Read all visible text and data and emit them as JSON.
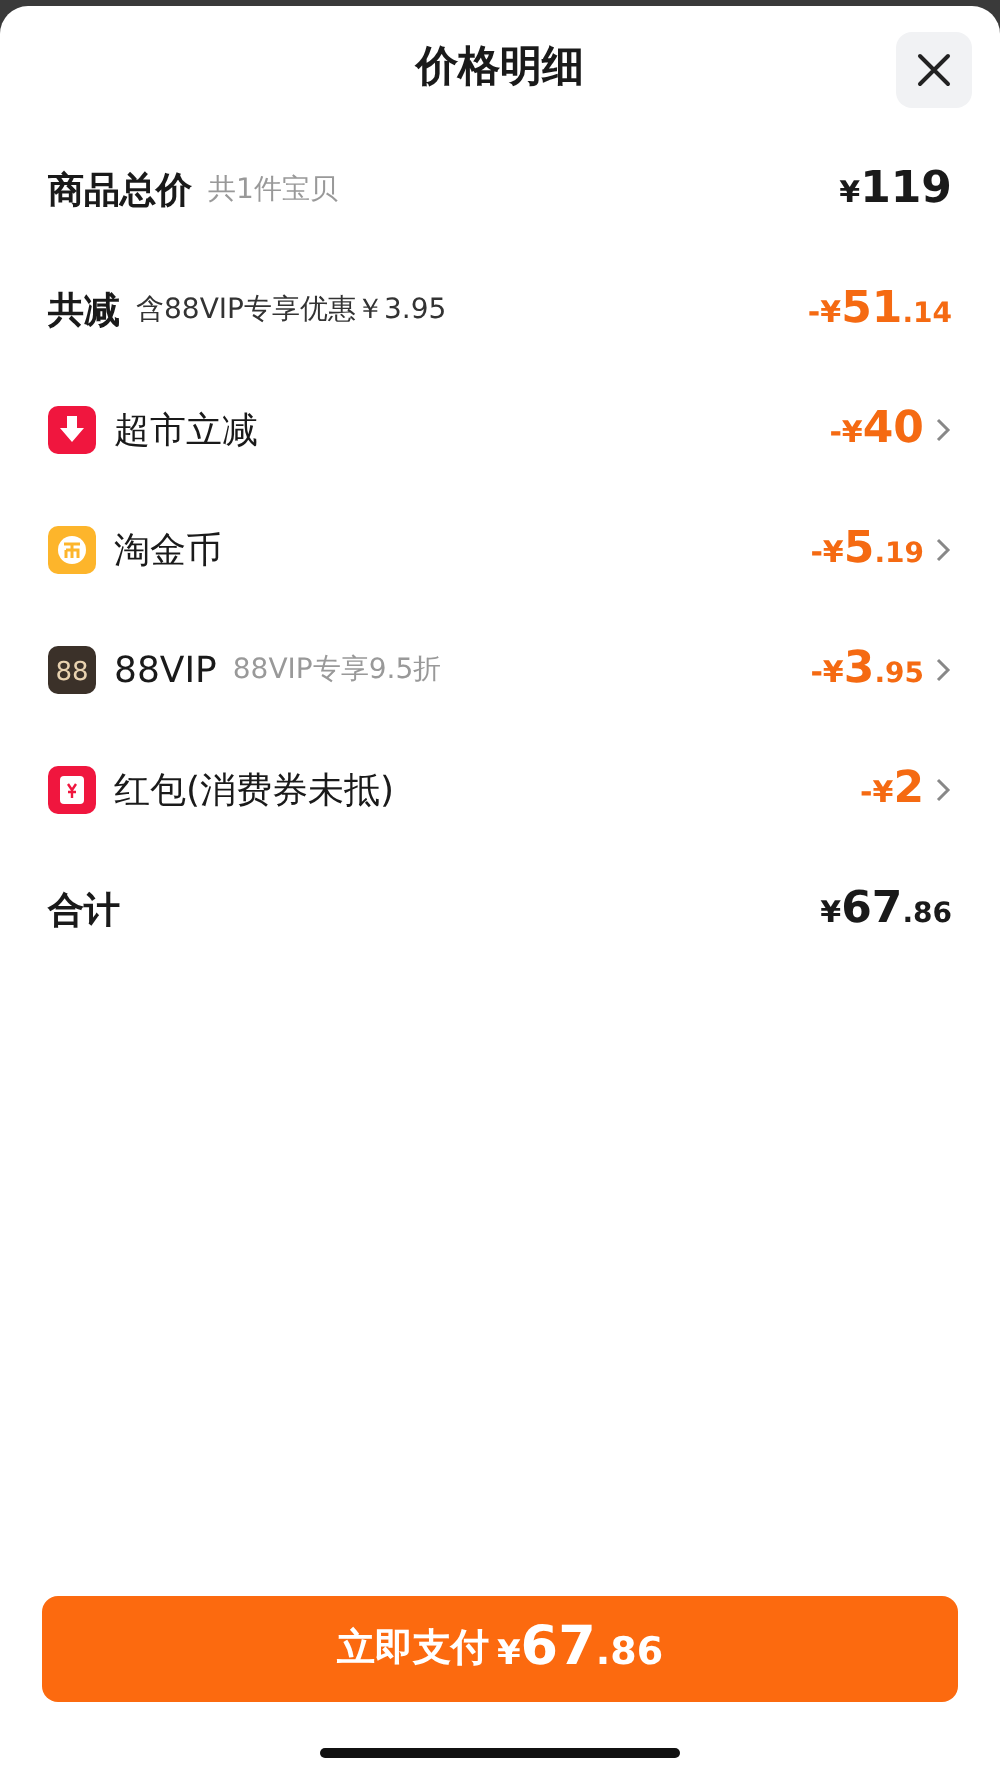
{
  "title": "价格明细",
  "rows": [
    {
      "kind": "summary",
      "label": "商品总价",
      "note": "共1件宝贝",
      "amount": {
        "sign": "¥",
        "whole": "119"
      }
    },
    {
      "kind": "summary_discount",
      "label": "共减",
      "note": "含88VIP专享优惠￥3.95",
      "amount": {
        "sign": "-¥",
        "whole": "51",
        "cents": ".14"
      }
    },
    {
      "kind": "discount",
      "label": "超市立减",
      "amount": {
        "sign": "-¥",
        "whole": "40"
      }
    },
    {
      "kind": "discount",
      "label": "淘金币",
      "amount": {
        "sign": "-¥",
        "whole": "5",
        "cents": ".19"
      }
    },
    {
      "kind": "discount",
      "icon_text": "88",
      "label": "88VIP",
      "note": "88VIP专享9.5折",
      "amount": {
        "sign": "-¥",
        "whole": "3",
        "cents": ".95"
      }
    },
    {
      "kind": "discount",
      "label": "红包(消费券未抵)",
      "amount": {
        "sign": "-¥",
        "whole": "2"
      }
    },
    {
      "kind": "total",
      "label": "合计",
      "amount": {
        "sign": "¥",
        "whole": "67",
        "cents": ".86"
      }
    }
  ],
  "pay_button": {
    "label": "立即支付",
    "amount": {
      "sign": "¥",
      "whole": "67",
      "cents": ".86"
    }
  }
}
